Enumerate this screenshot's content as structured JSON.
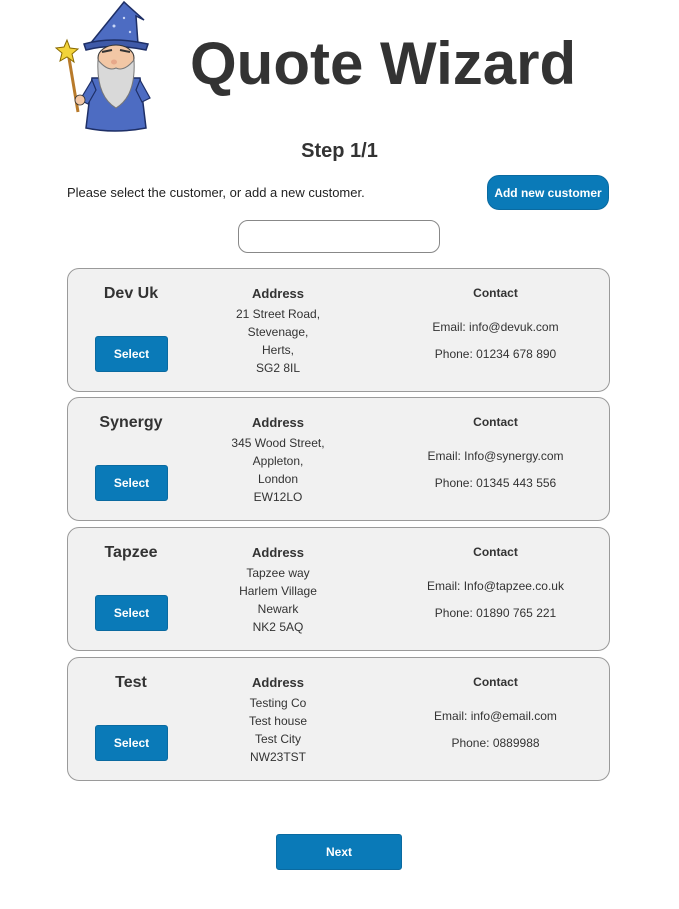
{
  "header": {
    "logo_icon": "wizard-icon",
    "title": "Quote Wizard"
  },
  "step": {
    "title": "Step 1/1"
  },
  "instruction": "Please select the customer, or add a new customer.",
  "add_button_label": "Add new customer",
  "search": {
    "value": "",
    "placeholder": ""
  },
  "address_heading": "Address",
  "contact_heading": "Contact",
  "select_label": "Select",
  "customers": [
    {
      "name": "Dev Uk",
      "address": [
        "21 Street Road,",
        "Stevenage,",
        "Herts,",
        "SG2 8IL"
      ],
      "email": "Email: info@devuk.com",
      "phone": "Phone: 01234 678 890"
    },
    {
      "name": "Synergy",
      "address": [
        "345 Wood Street,",
        "Appleton,",
        "London",
        "EW12LO"
      ],
      "email": "Email: Info@synergy.com",
      "phone": "Phone: 01345 443 556"
    },
    {
      "name": "Tapzee",
      "address": [
        "Tapzee way",
        "Harlem Village",
        "Newark",
        "NK2 5AQ"
      ],
      "email": "Email: Info@tapzee.co.uk",
      "phone": "Phone: 01890 765 221"
    },
    {
      "name": "Test",
      "address": [
        "Testing Co",
        "Test house",
        "Test City",
        "NW23TST"
      ],
      "email": "Email: info@email.com",
      "phone": "Phone: 0889988"
    }
  ],
  "next_label": "Next",
  "colors": {
    "primary_button": "#0a7ab8",
    "card_bg": "#f1f1f1",
    "card_border": "#9a9a9a",
    "text": "#333333"
  }
}
